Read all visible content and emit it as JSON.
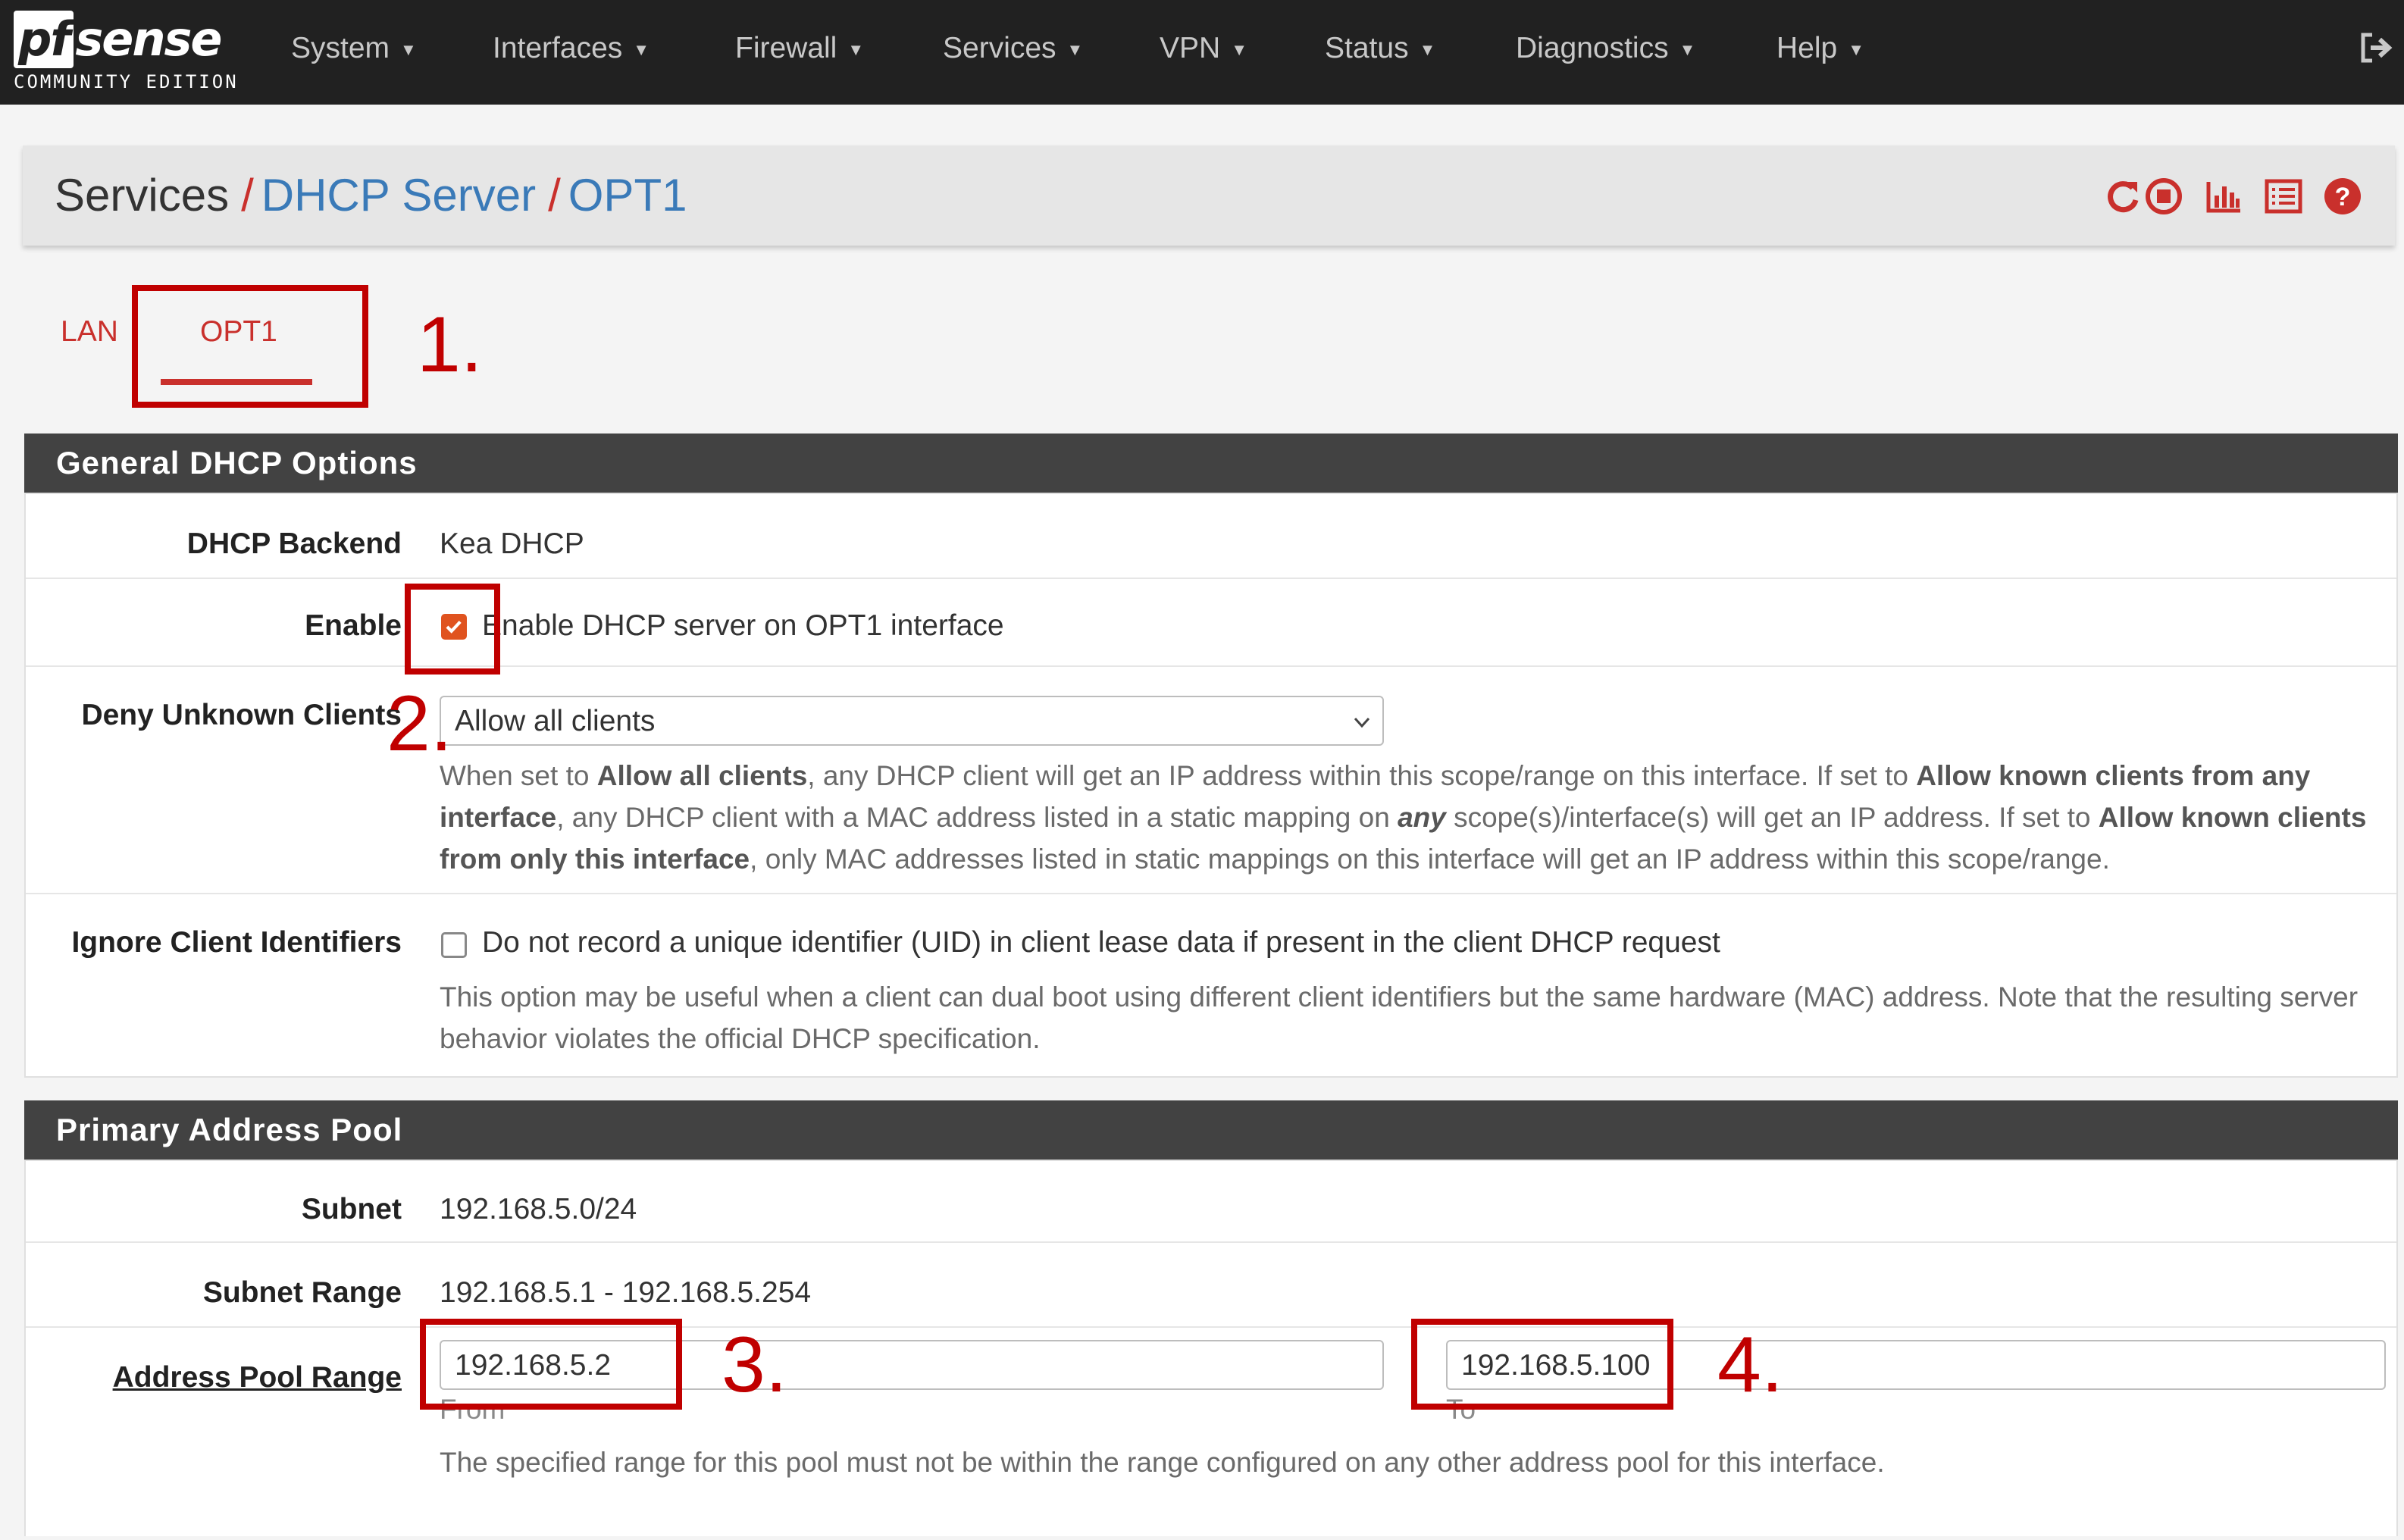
{
  "colors": {
    "navbar_bg": "#212121",
    "accent_red": "#c9302c",
    "link_blue": "#3a7ab8",
    "panel_header_bg": "#424242",
    "checkbox_orange": "#e0531f",
    "annotation_red": "#c00000"
  },
  "brand": {
    "logo_pf": "pf",
    "logo_sense": "sense",
    "edition": "COMMUNITY EDITION"
  },
  "nav": {
    "items": [
      {
        "label": "System"
      },
      {
        "label": "Interfaces"
      },
      {
        "label": "Firewall"
      },
      {
        "label": "Services"
      },
      {
        "label": "VPN"
      },
      {
        "label": "Status"
      },
      {
        "label": "Diagnostics"
      },
      {
        "label": "Help"
      }
    ],
    "logout_icon": "logout-icon"
  },
  "breadcrumb": {
    "items": [
      {
        "label": "Services"
      },
      {
        "label": "DHCP Server"
      },
      {
        "label": "OPT1"
      }
    ],
    "separator": "/",
    "icons": [
      "restart-service-icon",
      "stop-service-icon",
      "status-graph-icon",
      "log-list-icon",
      "help-icon"
    ]
  },
  "tabs": [
    {
      "label": "LAN",
      "active": false
    },
    {
      "label": "OPT1",
      "active": true
    }
  ],
  "annotations": [
    "1.",
    "2.",
    "3.",
    "4."
  ],
  "general": {
    "header": "General DHCP Options",
    "backend_label": "DHCP Backend",
    "backend_value": "Kea DHCP",
    "enable_label": "Enable",
    "enable_text": "Enable DHCP server on OPT1 interface",
    "enable_checked": true,
    "deny_label": "Deny Unknown Clients",
    "deny_selected": "Allow all clients",
    "deny_help": {
      "t1": "When set to ",
      "b1": "Allow all clients",
      "t2": ", any DHCP client will get an IP address within this scope/range on this interface. If set to ",
      "b2": "Allow known clients from any interface",
      "t3": ", any DHCP client with a MAC address listed in a static mapping on ",
      "b3": "any",
      "t4": " scope(s)/interface(s) will get an IP address. If set to ",
      "b4": "Allow known clients from only this interface",
      "t5": ", only MAC addresses listed in static mappings on this interface will get an IP address within this scope/range."
    },
    "ignore_label": "Ignore Client Identifiers",
    "ignore_text": "Do not record a unique identifier (UID) in client lease data if present in the client DHCP request",
    "ignore_checked": false,
    "ignore_help": "This option may be useful when a client can dual boot using different client identifiers but the same hardware (MAC) address. Note that the resulting server behavior violates the official DHCP specification."
  },
  "pool": {
    "header": "Primary Address Pool",
    "subnet_label": "Subnet",
    "subnet_value": "192.168.5.0/24",
    "range_label": "Subnet Range",
    "range_value": "192.168.5.1 - 192.168.5.254",
    "pool_label": "Address Pool Range",
    "from_value": "192.168.5.2",
    "from_caption": "From",
    "to_value": "192.168.5.100",
    "to_caption": "To",
    "pool_help": "The specified range for this pool must not be within the range configured on any other address pool for this interface."
  }
}
